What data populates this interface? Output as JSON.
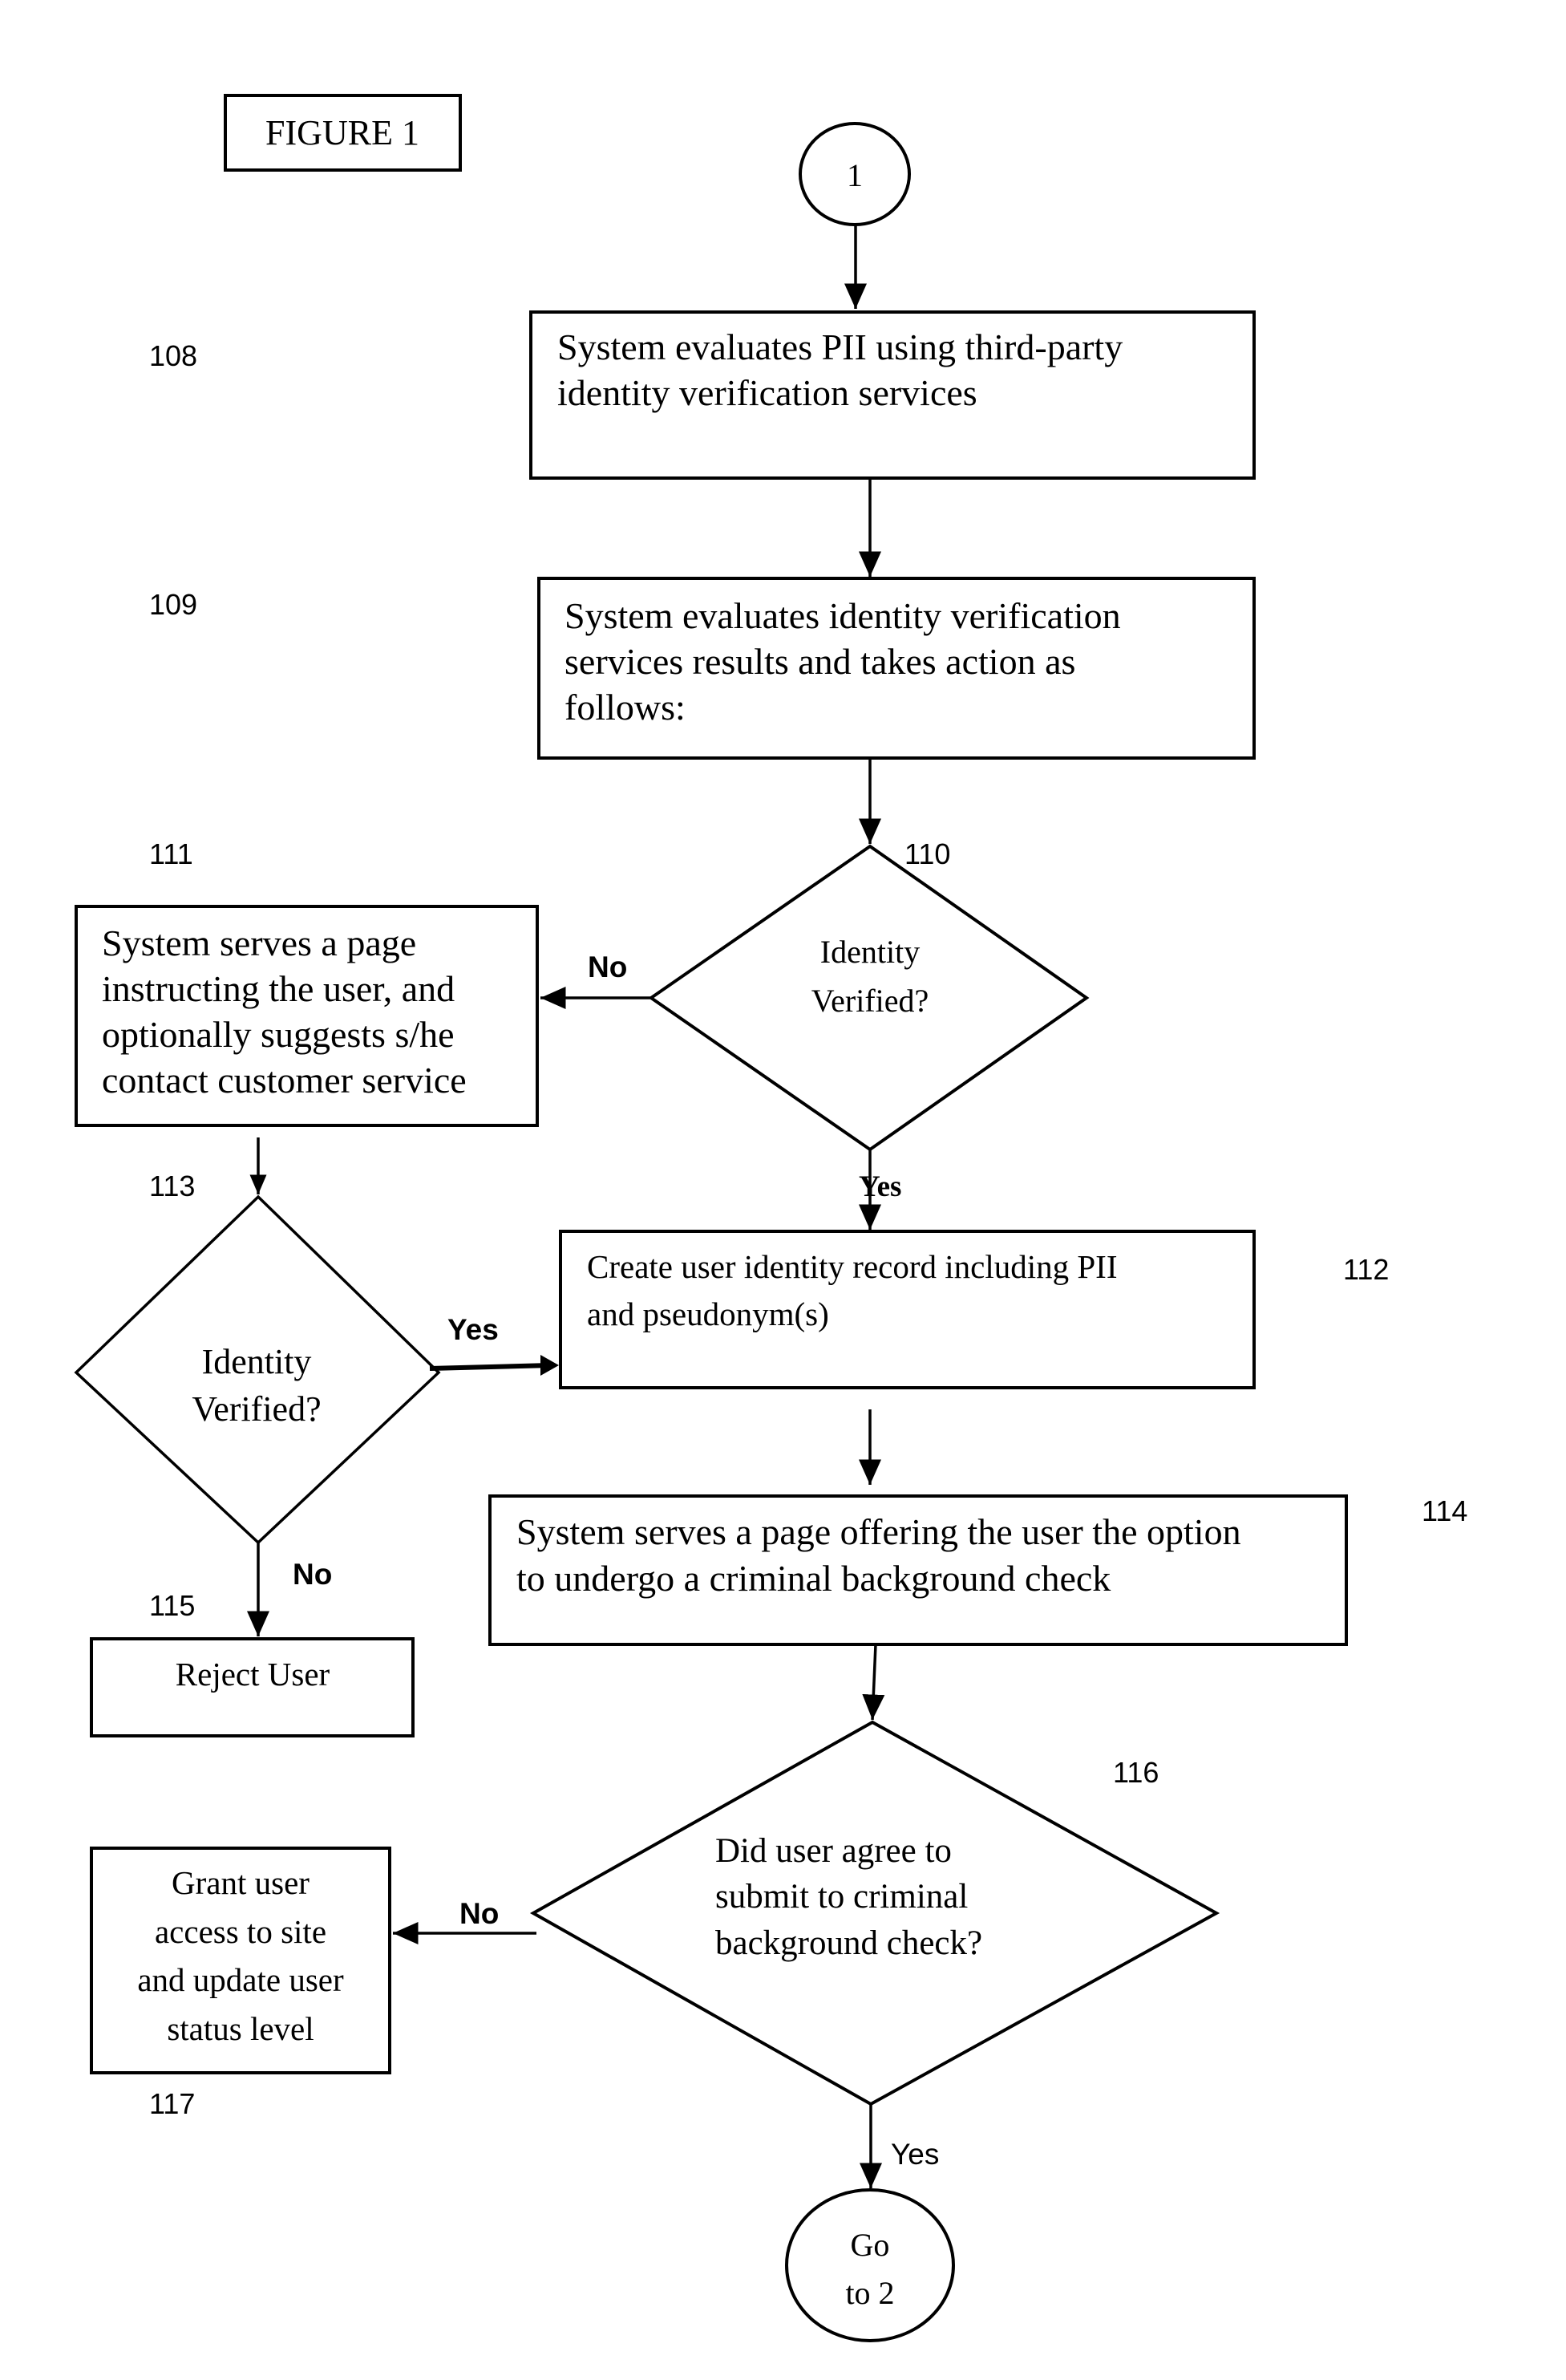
{
  "figure_title": "FIGURE 1",
  "connectors": {
    "start": "1",
    "end_line1": "Go",
    "end_line2": "to 2"
  },
  "reference_numbers": {
    "r108": "108",
    "r109": "109",
    "r110": "110",
    "r111": "111",
    "r112": "112",
    "r113": "113",
    "r114": "114",
    "r115": "115",
    "r116": "116",
    "r117": "117"
  },
  "steps": {
    "s108": [
      "System evaluates PII using third-party",
      "identity verification services"
    ],
    "s109": [
      "System evaluates identity verification",
      "services results and takes action as",
      "follows:"
    ],
    "s110": [
      "Identity",
      "Verified?"
    ],
    "s111": [
      "System serves a page",
      "instructing the user, and",
      "optionally suggests s/he",
      "contact customer service"
    ],
    "s112": [
      "Create user identity record including PII",
      "and pseudonym(s)"
    ],
    "s113": [
      "Identity",
      "Verified?"
    ],
    "s114": [
      "System serves a page offering the user the option",
      "to undergo a criminal background check"
    ],
    "s115": [
      "Reject User"
    ],
    "s116": [
      "Did user agree to",
      "submit to criminal",
      "background check?"
    ],
    "s117": [
      "Grant user",
      "access to site",
      "and update user",
      "status level"
    ]
  },
  "edge_labels": {
    "e110_no": "No",
    "e110_yes": "Yes",
    "e113_yes": "Yes",
    "e113_no": "No",
    "e116_no": "No",
    "e116_yes": "Yes"
  },
  "colors": {
    "line": "#000000",
    "background": "#ffffff"
  }
}
